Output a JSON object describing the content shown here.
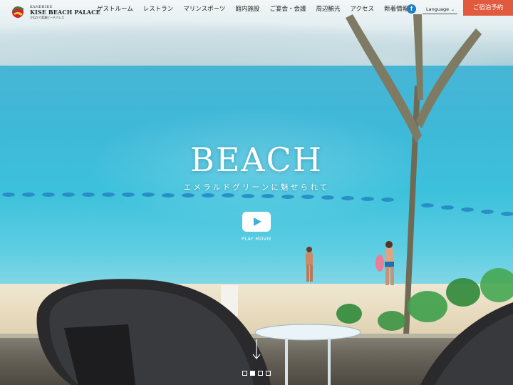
{
  "brand": {
    "kanehide": "KANEHIDE",
    "name": "KISE BEACH PALACE",
    "subtitle": "かねひで喜瀬ビーチパレス"
  },
  "nav": {
    "items": [
      "ゲストルーム",
      "レストラン",
      "マリンスポーツ",
      "館内施設",
      "ご宴会・会議",
      "周辺観光",
      "アクセス",
      "新着情報"
    ],
    "facebook_glyph": "f",
    "language": "Language",
    "reserve": "ご宿泊予約"
  },
  "hero": {
    "title": "BEACH",
    "subtitle": "エメラルドグリーンに魅せられて",
    "play_label": "PLAY MOVIE",
    "slides_total": 4,
    "active_slide": 2
  },
  "colors": {
    "accent": "#e15a3d",
    "facebook": "#1c7fc6",
    "play_icon": "#3fb3cf"
  },
  "icons": [
    "logo-emblem-icon",
    "facebook-icon",
    "chevron-down-icon",
    "play-icon",
    "arrow-down-icon"
  ]
}
